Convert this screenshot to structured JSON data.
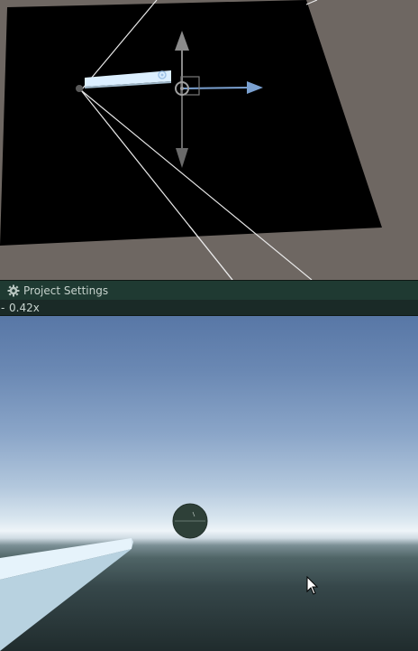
{
  "window": {
    "tab_title": "Project Settings",
    "tab_icon": "gear-icon"
  },
  "game_toolbar": {
    "scale_prefix": "-",
    "scale_value": "0.42x"
  },
  "colors": {
    "scene_background": "#6e6762",
    "plane": "#000000",
    "tab_bar": "#1f3a32",
    "gizmo_axis": "#7aa0d0",
    "sky_top": "#5877a6",
    "horizon": "#eef4f8",
    "ground": "#202c2d"
  },
  "icons": {
    "gear": "gear-icon",
    "move_gizmo": "move-gizmo-icon",
    "camera": "camera-icon",
    "light": "light-icon",
    "cursor": "mouse-cursor-icon"
  }
}
